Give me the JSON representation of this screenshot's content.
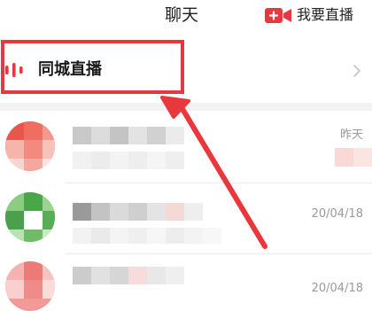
{
  "header": {
    "title": "聊天",
    "live_button_label": "我要直播"
  },
  "local_live": {
    "label": "同城直播"
  },
  "chats": [
    {
      "time": "昨天"
    },
    {
      "time": "20/04/18"
    },
    {
      "time": "20/04/18"
    }
  ],
  "colors": {
    "accent_red": "#e43a3f",
    "annotation_red": "#e8383d",
    "separator": "#f2f2f2",
    "time_text": "#999999"
  },
  "icons": {
    "live_button": "video-camera-icon",
    "local_live": "sound-bars-icon",
    "row_chevron": "chevron-right-icon"
  }
}
